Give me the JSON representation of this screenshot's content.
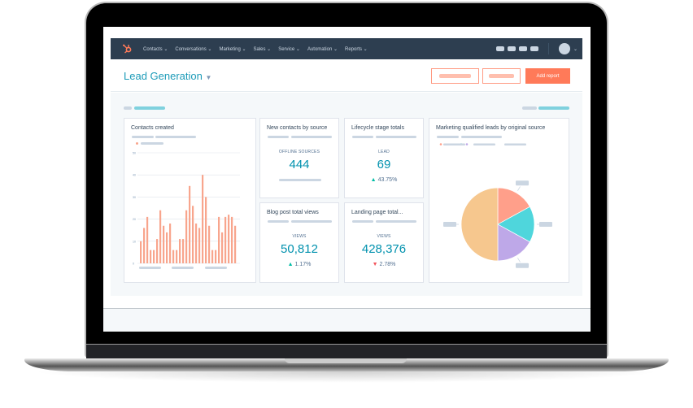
{
  "nav": {
    "items": [
      "Contacts",
      "Conversations",
      "Marketing",
      "Sales",
      "Service",
      "Automation",
      "Reports"
    ]
  },
  "header": {
    "title": "Lead Generation",
    "add_report": "Add report"
  },
  "cards": {
    "contacts_created": {
      "title": "Contacts created"
    },
    "new_contacts": {
      "title": "New contacts by source",
      "label": "OFFLINE SOURCES",
      "value": "444"
    },
    "lifecycle": {
      "title": "Lifecycle stage totals",
      "label": "LEAD",
      "value": "69",
      "change": "43.75%",
      "direction": "up"
    },
    "blog": {
      "title": "Blog post total views",
      "label": "VIEWS",
      "value": "50,812",
      "change": "1.17%",
      "direction": "up"
    },
    "landing": {
      "title": "Landing page total...",
      "label": "VIEWS",
      "value": "428,376",
      "change": "2.78%",
      "direction": "down"
    },
    "mql": {
      "title": "Marketing qualified leads by original source"
    }
  },
  "colors": {
    "accent": "#ff7a59",
    "nav": "#2d3e50",
    "teal": "#0091ae",
    "up": "#00bda5",
    "down": "#f2545b"
  },
  "chart_data": [
    {
      "type": "bar",
      "title": "Contacts created",
      "yticks": [
        "0",
        "10",
        "20",
        "30",
        "40",
        "50"
      ],
      "ylim": [
        0,
        50
      ],
      "grid": true,
      "color": "#f8a58d",
      "values": [
        10,
        16,
        21,
        6,
        6,
        11,
        24,
        17,
        14,
        18,
        6,
        6,
        11,
        11,
        24,
        35,
        26,
        18,
        16,
        40,
        30,
        17,
        6,
        6,
        21,
        14,
        21,
        22,
        21,
        17
      ]
    },
    {
      "type": "pie",
      "title": "Marketing qualified leads by original source",
      "values": [
        17,
        16,
        17,
        50
      ],
      "colors": [
        "#ff9f8a",
        "#4fd6dc",
        "#bea8e8",
        "#f6c78e"
      ]
    }
  ]
}
